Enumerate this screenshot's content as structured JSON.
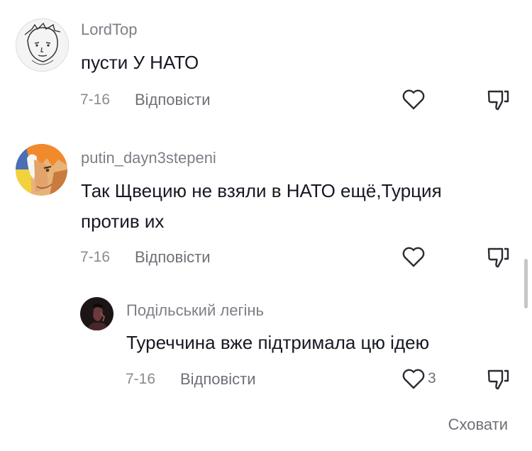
{
  "comments": [
    {
      "username": "LordTop",
      "text": "пусти У НАТО",
      "date": "7-16",
      "reply_label": "Відповісти",
      "avatar": "sketch-face-avatar"
    },
    {
      "username": "putin_dayn3stepeni",
      "text_lines": [
        "Так Щвецию не взяли в НАТО ещё,Турция",
        "против их"
      ],
      "date": "7-16",
      "reply_label": "Відповісти",
      "avatar": "anime-character-avatar"
    }
  ],
  "reply": {
    "username": "Подільський легінь",
    "text": "Туреччина вже підтримала цю ідею",
    "date": "7-16",
    "reply_label": "Відповісти",
    "like_count": "3",
    "avatar": "dark-portrait-avatar"
  },
  "hide_label": "Сховати",
  "icons": {
    "like": "heart-icon",
    "dislike": "thumbs-down-icon"
  },
  "colors": {
    "text": "#161823",
    "secondary": "#8a8b91",
    "background": "#ffffff"
  }
}
